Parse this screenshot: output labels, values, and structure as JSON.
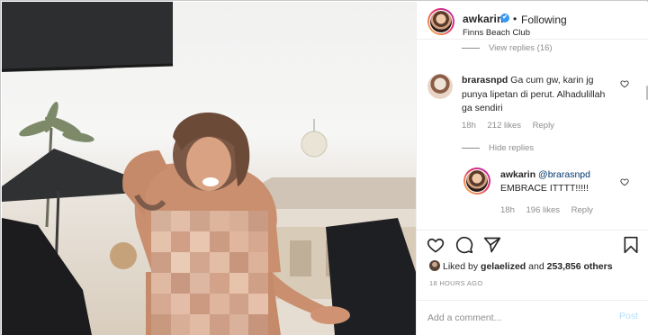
{
  "header": {
    "username": "awkarin",
    "follow_state": "Following",
    "dot": "•",
    "location": "Finns Beach Club",
    "verified_icon": "✔"
  },
  "comments": {
    "view_replies": "View replies (16)",
    "items": [
      {
        "username": "brarasnpd",
        "text": "Ga cum gw, karin jg punya lipetan di perut. Alhadulillah ga sendiri",
        "time": "18h",
        "likes": "212 likes",
        "reply": "Reply"
      }
    ],
    "hide_replies": "Hide replies",
    "replies": [
      {
        "username": "awkarin",
        "mention": "@brarasnpd",
        "text": "EMBRACE ITTTT!!!!!",
        "time": "18h",
        "likes": "196 likes",
        "reply": "Reply"
      }
    ]
  },
  "actions": {
    "icons": [
      "heart-icon",
      "comment-icon",
      "share-icon",
      "bookmark-icon"
    ]
  },
  "likes": {
    "prefix": "Liked by",
    "user": "gelaelized",
    "and": "and",
    "others": "253,856 others"
  },
  "timestamp": "18 HOURS AGO",
  "add_comment": {
    "placeholder": "Add a comment...",
    "post_label": "Post"
  },
  "colors": {
    "link": "#00376b",
    "verified": "#3897f0",
    "muted": "#8e8e8e",
    "post_disabled": "#b2dffc"
  }
}
